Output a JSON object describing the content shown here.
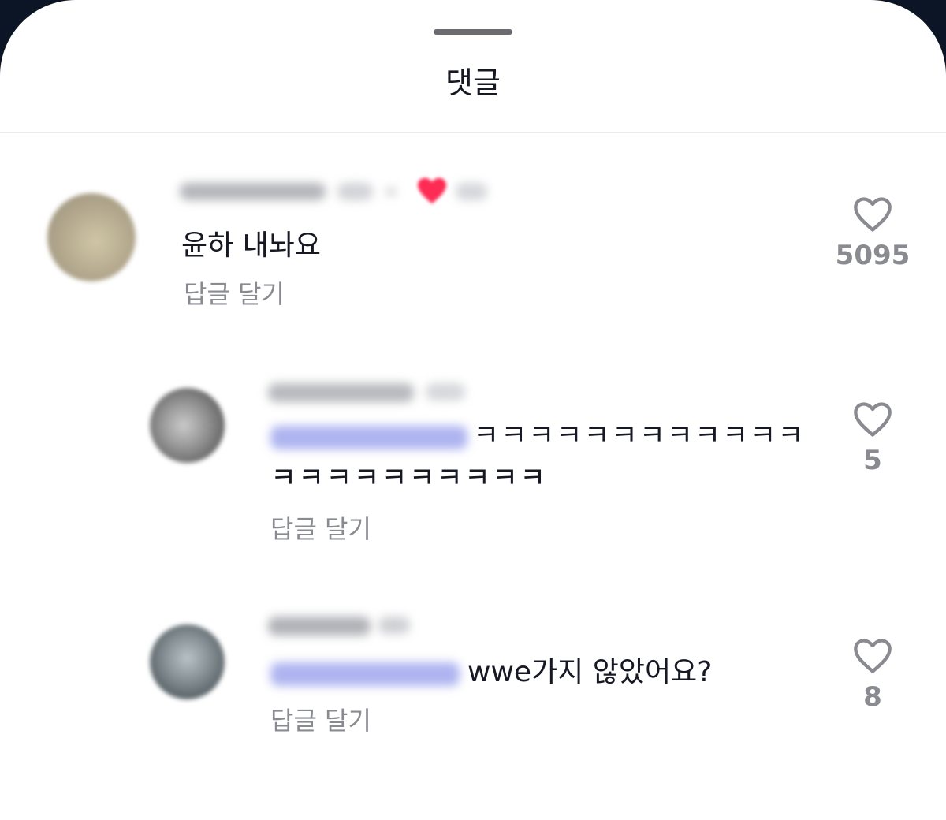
{
  "sheet": {
    "title": "댓글"
  },
  "comments": [
    {
      "text": "윤하 내놔요",
      "reply_label": "답글 달기",
      "likes": "5095"
    },
    {
      "text_line1": "ㅋㅋㅋㅋㅋㅋㅋㅋㅋㅋㅋㅋ",
      "text_line2": "ㅋㅋㅋㅋㅋㅋㅋㅋㅋㅋ",
      "reply_label": "답글 달기",
      "likes": "5"
    },
    {
      "text": "wwe가지 않았어요?",
      "reply_label": "답글 달기",
      "likes": "8"
    }
  ],
  "icons": {
    "like": "heart-outline-icon",
    "creator_liked": "heart-filled-icon"
  },
  "colors": {
    "muted": "#8a8b91",
    "text": "#161823",
    "mention": "#6f78d6",
    "liked": "#fe2c55"
  }
}
